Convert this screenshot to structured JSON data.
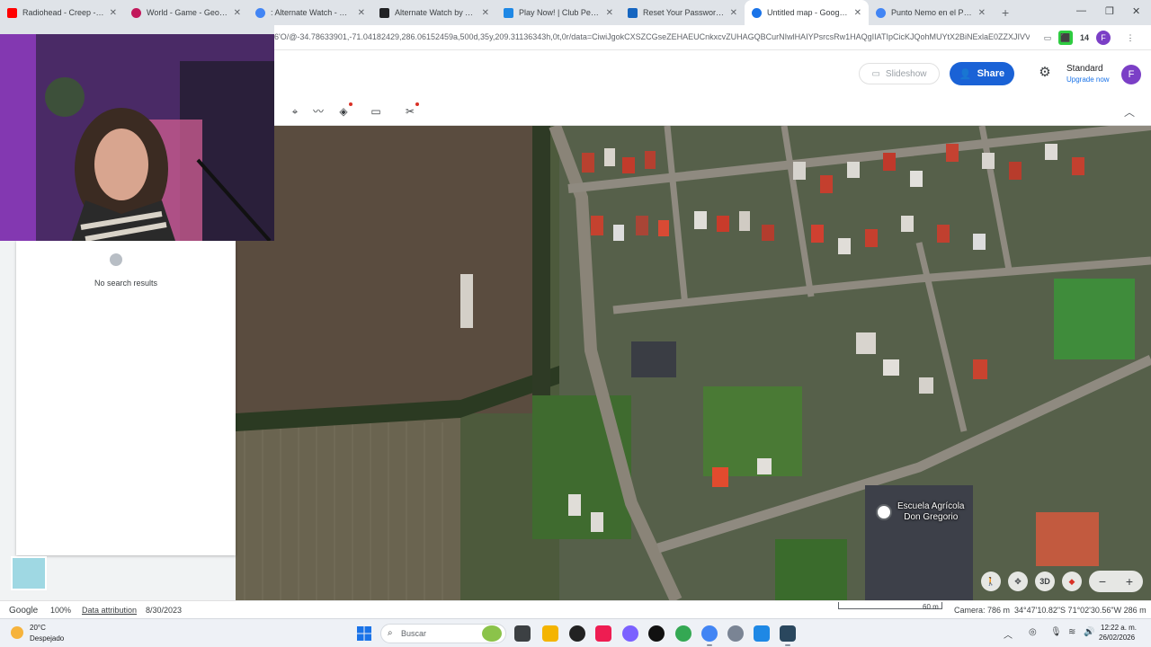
{
  "browser": {
    "tabs": [
      {
        "title": "Radiohead - Creep - YouTube",
        "color": "#ff0000",
        "active": false
      },
      {
        "title": "World - Game - GeoGuessr",
        "color": "#c2185b",
        "active": false
      },
      {
        "title": ": Alternate Watch - Google",
        "color": "#4285f4",
        "active": false
      },
      {
        "title": "Alternate Watch by Tesse",
        "color": "#202124",
        "active": false
      },
      {
        "title": "Play Now! | Club Penguin",
        "color": "#1e88e5",
        "active": false
      },
      {
        "title": "Reset Your Password | Clu",
        "color": "#1565c0",
        "active": false
      },
      {
        "title": "Untitled map - Google Earth",
        "color": "#1a73e8",
        "active": true
      },
      {
        "title": "Punto Nemo en el Pacífico",
        "color": "#4285f4",
        "active": false
      }
    ],
    "new_tab": "+",
    "url": "6'O/@-34.78633901,-71.04182429,286.06152459a,500d,35y,209.31136343h,0t,0r/data=CiwiJgokCXSZCGseZEHAEUCnkxcvZUHAGQBCurNIwlHAIYPsrcsRw1HAQgIIATIpCicKJQohMUYtX2BiNExlaE0ZZXJIVVV...",
    "profile_initial": "F",
    "extension_badge": "14"
  },
  "earth": {
    "slideshow_label": "Slideshow",
    "share_label": "Share",
    "plan_name": "Standard",
    "upgrade_label": "Upgrade now",
    "avatar_initial": "F",
    "tools": [
      "placemark",
      "path",
      "layers",
      "measure",
      "tools"
    ]
  },
  "search_panel": {
    "no_results": "No search results"
  },
  "map": {
    "poi_name_line1": "Escuela Agrícola",
    "poi_name_line2": "Don Gregorio"
  },
  "status": {
    "google": "Google",
    "zoom": "100%",
    "attribution": "Data attribution",
    "imagery_date": "8/30/2023",
    "scale": "60 m",
    "camera": "Camera: 786 m",
    "coords": "34°47'10.82\"S 71°02'30.56\"W  286 m"
  },
  "taskbar": {
    "temp": "20°C",
    "weather": "Despejado",
    "search_placeholder": "Buscar",
    "time": "12:22 a. m.",
    "date": "26/02/2026"
  },
  "colors": {
    "accent": "#1a62d6",
    "avatar": "#7b3fc6"
  }
}
